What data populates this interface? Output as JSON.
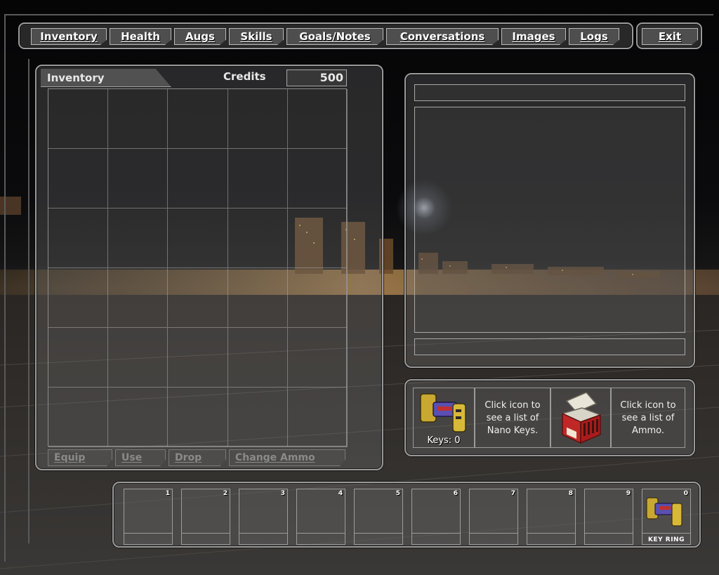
{
  "nav": {
    "tabs": [
      {
        "label": "Inventory"
      },
      {
        "label": "Health"
      },
      {
        "label": "Augs"
      },
      {
        "label": "Skills"
      },
      {
        "label": "Goals/Notes"
      },
      {
        "label": "Conversations"
      },
      {
        "label": "Images"
      },
      {
        "label": "Logs"
      }
    ],
    "exit_label": "Exit"
  },
  "inventory": {
    "title": "Inventory",
    "credits_label": "Credits",
    "credits_value": "500",
    "actions": {
      "equip": "Equip",
      "use": "Use",
      "drop": "Drop",
      "change_ammo": "Change Ammo"
    }
  },
  "keys": {
    "hint": "Click icon to see a list of Nano Keys.",
    "count_label": "Keys: 0",
    "icon": "nano-keyring-icon"
  },
  "ammo": {
    "hint": "Click icon to see a list of Ammo.",
    "icon": "ammo-crate-icon"
  },
  "belt": {
    "slots": [
      {
        "number": "1"
      },
      {
        "number": "2"
      },
      {
        "number": "3"
      },
      {
        "number": "4"
      },
      {
        "number": "5"
      },
      {
        "number": "6"
      },
      {
        "number": "7"
      },
      {
        "number": "8"
      },
      {
        "number": "9"
      }
    ],
    "key_ring": {
      "number": "0",
      "label": "KEY RING"
    }
  },
  "colors": {
    "panel_border": "#9a9a9a",
    "text": "#ffffff",
    "disabled_text": "#8a8a8a"
  }
}
